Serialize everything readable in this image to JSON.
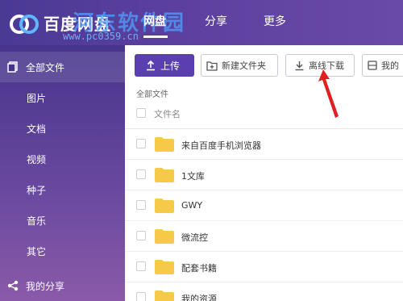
{
  "header": {
    "app_title": "百度网盘",
    "watermark_text": "河东软件园",
    "watermark_url": "www.pc0359.cn",
    "tabs": [
      {
        "label": "网盘"
      },
      {
        "label": "分享"
      },
      {
        "label": "更多"
      }
    ]
  },
  "sidebar": {
    "items": [
      {
        "label": "全部文件"
      },
      {
        "label": "图片"
      },
      {
        "label": "文档"
      },
      {
        "label": "视频"
      },
      {
        "label": "种子"
      },
      {
        "label": "音乐"
      },
      {
        "label": "其它"
      },
      {
        "label": "我的分享"
      }
    ]
  },
  "toolbar": {
    "upload_label": "上传",
    "new_folder_label": "新建文件夹",
    "offline_download_label": "离线下载",
    "my_device_label": "我的"
  },
  "breadcrumb": "全部文件",
  "file_list": {
    "header_label": "文件名",
    "files": [
      {
        "name": "来自百度手机浏览器"
      },
      {
        "name": "1文库"
      },
      {
        "name": "GWY"
      },
      {
        "name": "微流控"
      },
      {
        "name": "配套书籍"
      },
      {
        "name": "我的资源"
      }
    ]
  },
  "colors": {
    "accent": "#5a3fb0",
    "folder": "#f7c948",
    "annotation_arrow": "#e02020"
  }
}
